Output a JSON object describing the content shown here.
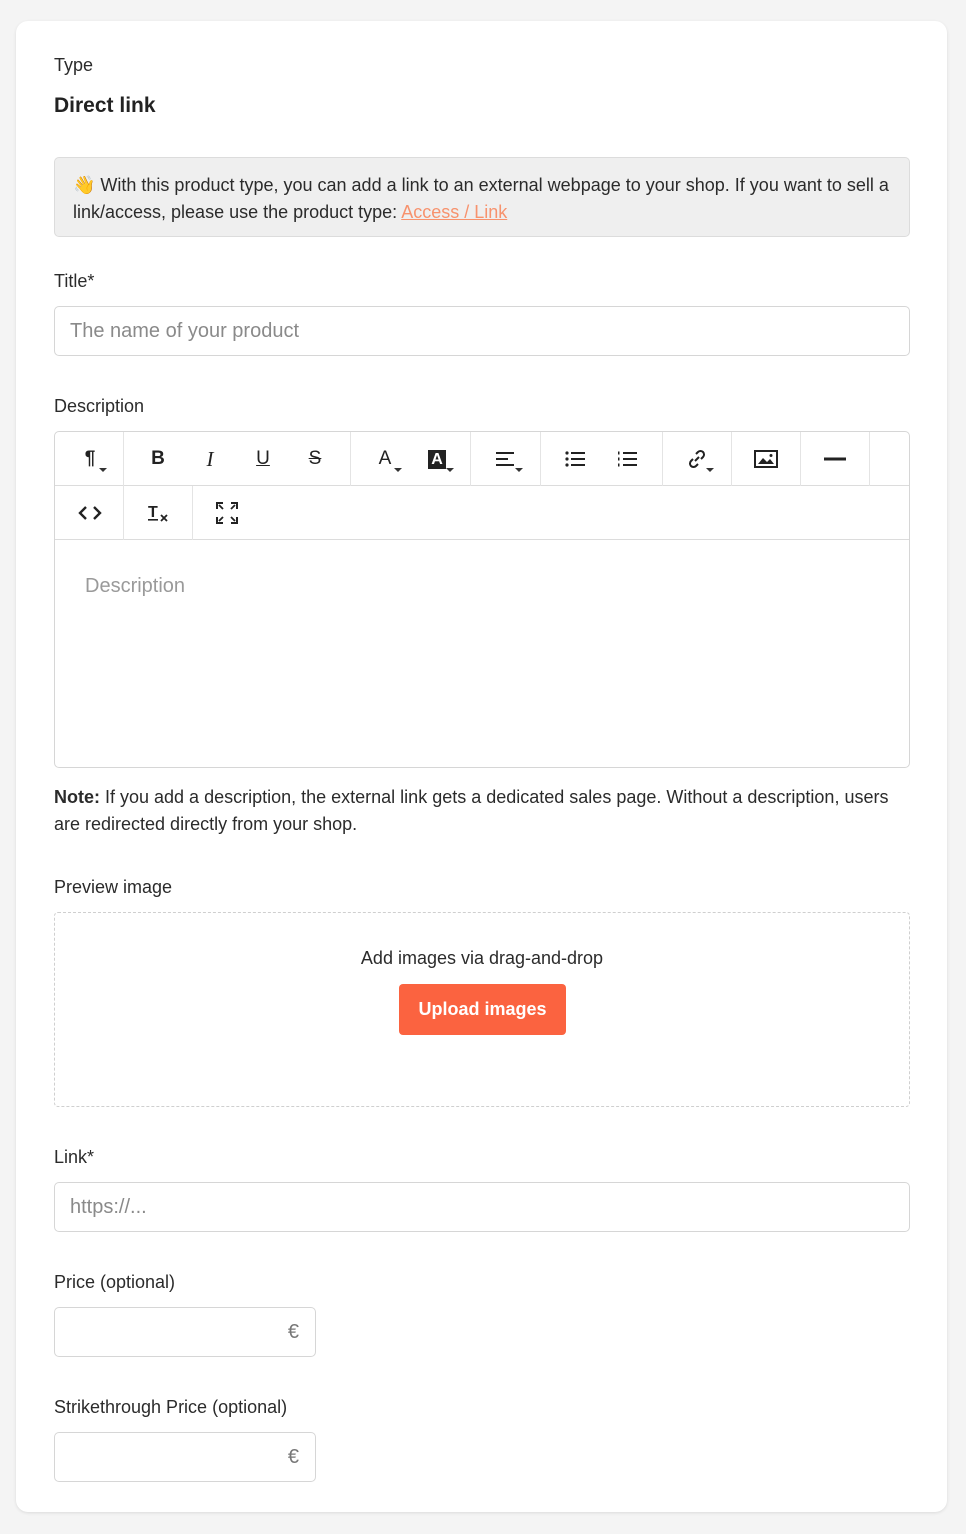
{
  "type_section": {
    "label": "Type",
    "value": "Direct link"
  },
  "info": {
    "emoji": "👋",
    "text": " With this product type, you can add a link to an external webpage to your shop. If you want to sell a link/access, please use the product type: ",
    "link_text": "Access / Link"
  },
  "title_field": {
    "label": "Title*",
    "placeholder": "The name of your product"
  },
  "description_field": {
    "label": "Description",
    "placeholder": "Description",
    "toolbar": {
      "paragraph_icon": "¶",
      "bold_icon": "B",
      "italic_icon": "I",
      "underline_icon": "U",
      "strike_icon": "S",
      "font_color_icon": "A",
      "bg_color_icon": "A"
    }
  },
  "note": {
    "prefix": "Note:",
    "text": " If you add a description, the external link gets a dedicated sales page. Without a description, users are redirected directly from your shop."
  },
  "preview_image": {
    "label": "Preview image",
    "dropzone_text": "Add images via drag-and-drop",
    "upload_button": "Upload images"
  },
  "link_field": {
    "label": "Link*",
    "placeholder": "https://..."
  },
  "price_field": {
    "label": "Price (optional)",
    "currency": "€"
  },
  "strike_price_field": {
    "label": "Strikethrough Price (optional)",
    "currency": "€"
  },
  "colors": {
    "accent": "#fb6340",
    "link": "#f7926d"
  }
}
